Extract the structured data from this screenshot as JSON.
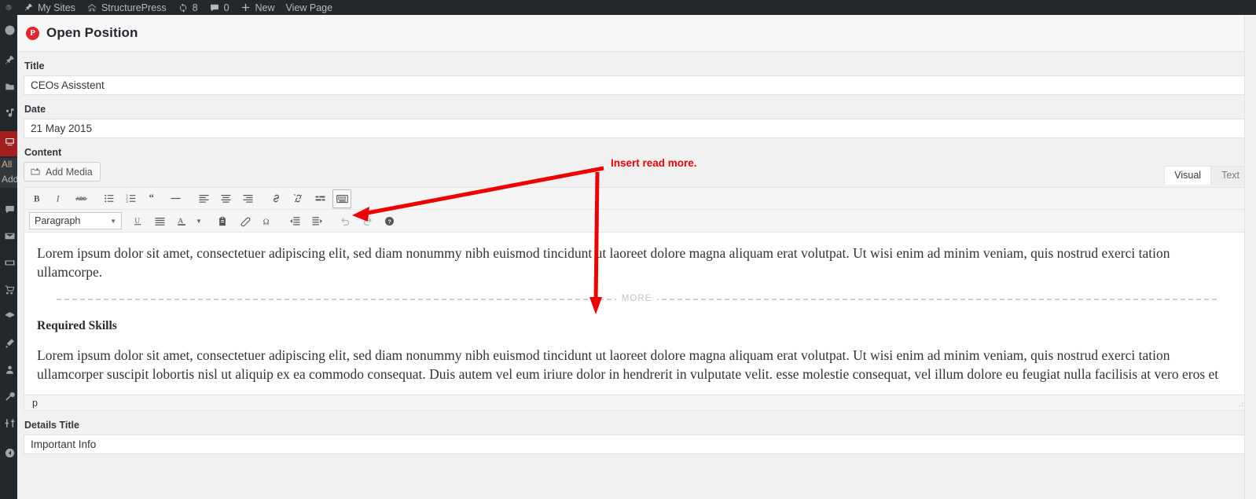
{
  "adminbar": {
    "logo_icon": "wordpress-logo-icon",
    "items": [
      {
        "label": "My Sites",
        "icon": "pushpin-icon"
      },
      {
        "label": "StructurePress",
        "icon": "home-icon"
      },
      {
        "label": "8",
        "icon": "updates-icon"
      },
      {
        "label": "0",
        "icon": "comment-icon"
      },
      {
        "label": "New",
        "icon": "plus-icon"
      },
      {
        "label": "View Page",
        "icon": ""
      }
    ]
  },
  "adminmenu": {
    "icons": [
      "dashboard-icon",
      "pushpin-icon",
      "media-icon",
      "portfolio-icon",
      "open-position-icon",
      "comments-icon",
      "mail-icon",
      "slider-icon",
      "cart-icon",
      "layers-icon",
      "appearance-icon",
      "users-icon",
      "tools-icon",
      "settings-icon",
      "collapse-icon"
    ],
    "submenu": [
      {
        "label": "All",
        "current": true
      },
      {
        "label": "Add",
        "current": false
      }
    ]
  },
  "page": {
    "title": "Open Position",
    "badge_letter": "P",
    "badge_color": "#e7232c"
  },
  "fields": {
    "title": {
      "label": "Title",
      "value": "CEOs Asisstent"
    },
    "date": {
      "label": "Date",
      "value": "21 May 2015"
    },
    "content": {
      "label": "Content"
    },
    "details_title": {
      "label": "Details Title",
      "value": "Important Info"
    }
  },
  "editor": {
    "add_media_label": "Add Media",
    "add_media_icon": "media-add-icon",
    "tabs": [
      {
        "label": "Visual",
        "active": true
      },
      {
        "label": "Text",
        "active": false
      }
    ],
    "toolbar_row1": [
      {
        "name": "bold-icon",
        "title": "Bold"
      },
      {
        "name": "italic-icon",
        "title": "Italic"
      },
      {
        "name": "strikethrough-icon",
        "title": "Strikethrough"
      },
      {
        "name": "bullet-list-icon",
        "title": "Bulleted list"
      },
      {
        "name": "numbered-list-icon",
        "title": "Numbered list"
      },
      {
        "name": "blockquote-icon",
        "title": "Blockquote"
      },
      {
        "name": "horizontal-rule-icon",
        "title": "Horizontal line"
      },
      {
        "name": "align-left-icon",
        "title": "Align left"
      },
      {
        "name": "align-center-icon",
        "title": "Align center"
      },
      {
        "name": "align-right-icon",
        "title": "Align right"
      },
      {
        "name": "insert-link-icon",
        "title": "Insert link"
      },
      {
        "name": "remove-link-icon",
        "title": "Remove link"
      },
      {
        "name": "insert-read-more-icon",
        "title": "Insert Read More tag"
      },
      {
        "name": "toggle-toolbar-icon",
        "title": "Toolbar Toggle"
      }
    ],
    "format_select": {
      "value": "Paragraph",
      "caret_icon": "chevron-down-icon"
    },
    "toolbar_row2": [
      {
        "name": "underline-icon",
        "title": "Underline"
      },
      {
        "name": "justify-icon",
        "title": "Justify"
      },
      {
        "name": "text-color-icon",
        "title": "Text color"
      },
      {
        "name": "text-color-caret-icon",
        "title": "Text color options"
      },
      {
        "name": "paste-as-text-icon",
        "title": "Paste as text"
      },
      {
        "name": "clear-formatting-icon",
        "title": "Clear formatting"
      },
      {
        "name": "special-character-icon",
        "title": "Special character"
      },
      {
        "name": "outdent-icon",
        "title": "Decrease indent"
      },
      {
        "name": "indent-icon",
        "title": "Increase indent"
      },
      {
        "name": "undo-icon",
        "title": "Undo"
      },
      {
        "name": "redo-icon",
        "title": "Redo"
      },
      {
        "name": "help-icon",
        "title": "Keyboard Shortcuts"
      }
    ],
    "content": {
      "paragraph1": "Lorem ipsum dolor sit amet, consectetuer adipiscing elit, sed diam nonummy nibh euismod tincidunt ut laoreet dolore magna aliquam erat volutpat. Ut wisi enim ad minim veniam, quis nostrud exerci tation ullamcorpe.",
      "more_label": "MORE",
      "heading": "Required Skills",
      "paragraph2": "Lorem ipsum dolor sit amet, consectetuer adipiscing elit, sed diam nonummy nibh euismod tincidunt ut laoreet dolore magna aliquam erat volutpat. Ut wisi enim ad minim veniam, quis nostrud exerci tation ullamcorper suscipit lobortis nisl ut aliquip ex ea commodo consequat. Duis autem vel eum iriure dolor in hendrerit in vulputate velit. esse molestie consequat, vel illum dolore eu feugiat nulla facilisis at vero eros et"
    },
    "status_path": "p",
    "resize_handle_icon": "resize-grip-icon"
  },
  "annotation": {
    "text": "Insert read more.",
    "color": "#ee0000",
    "arrows": [
      {
        "name": "arrow-to-toolbar-button"
      },
      {
        "name": "arrow-to-more-divider"
      }
    ]
  }
}
